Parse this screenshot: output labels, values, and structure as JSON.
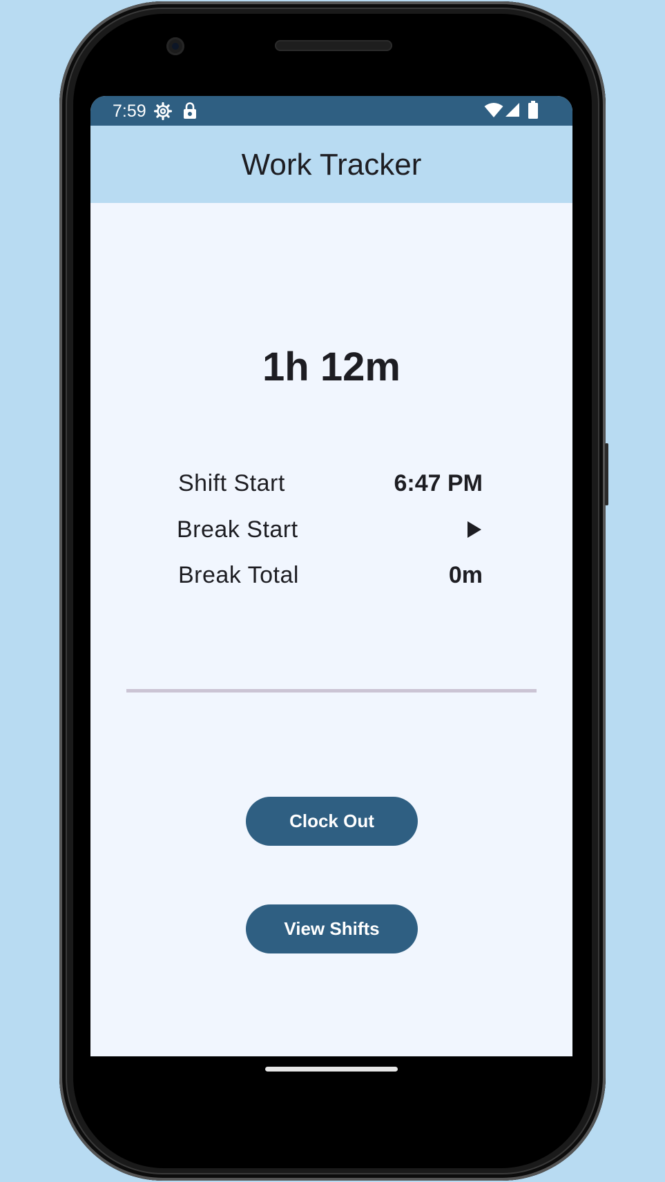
{
  "status_bar": {
    "time": "7:59",
    "icons": [
      "settings-gear-icon",
      "lock-icon",
      "wifi-icon",
      "cell-signal-icon",
      "battery-icon"
    ]
  },
  "app_bar": {
    "title": "Work Tracker"
  },
  "tracker": {
    "elapsed": "1h 12m",
    "rows": [
      {
        "label": "Shift Start",
        "value": "6:47 PM"
      },
      {
        "label": "Break Start",
        "value_icon": "play-icon"
      },
      {
        "label": "Break Total",
        "value": "0m"
      }
    ]
  },
  "actions": {
    "clock_out_label": "Clock Out",
    "view_shifts_label": "View Shifts"
  },
  "colors": {
    "status_bar": "#2f5f82",
    "app_bar": "#b8dbf2",
    "screen_background": "#f1f6fe",
    "button": "#2f5f82",
    "divider": "#cbc4d4",
    "page_background": "#b8dbf2"
  }
}
